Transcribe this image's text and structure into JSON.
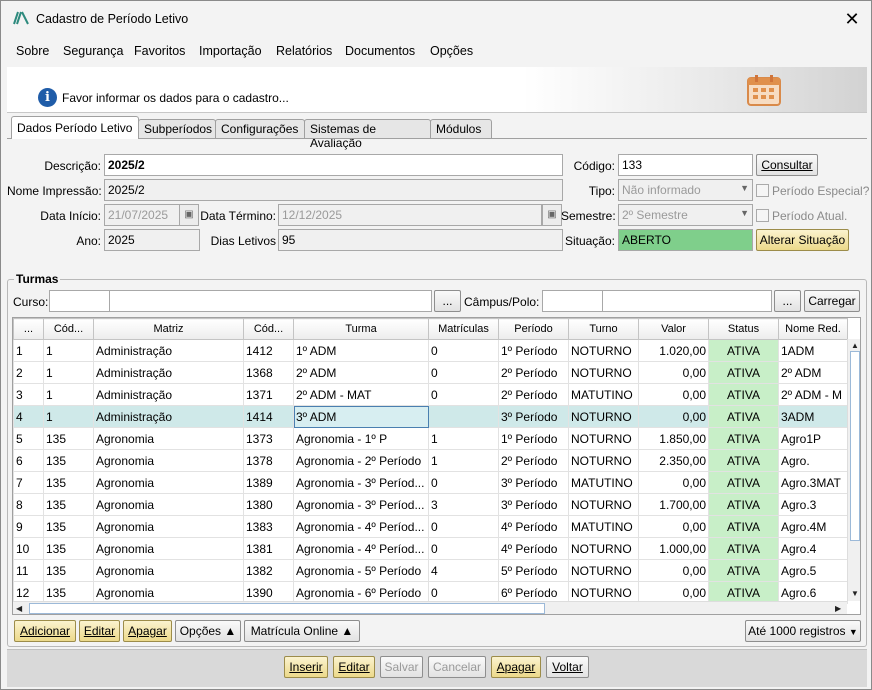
{
  "window": {
    "title": "Cadastro de Período Letivo",
    "close_label": "✕"
  },
  "menu": [
    "Sobre",
    "Segurança",
    "Favoritos",
    "Importação",
    "Relatórios",
    "Documentos",
    "Opções"
  ],
  "info": {
    "message": "Favor informar os dados para o cadastro..."
  },
  "tabs": [
    "Dados Período Letivo",
    "Subperíodos",
    "Configurações",
    "Sistemas de Avaliação",
    "Módulos"
  ],
  "form": {
    "descricao_label": "Descrição:",
    "descricao": "2025/2",
    "nome_impressao_label": "Nome Impressão:",
    "nome_impressao": "2025/2",
    "data_inicio_label": "Data Início:",
    "data_inicio": "21/07/2025",
    "data_termino_label": "Data Término:",
    "data_termino": "12/12/2025",
    "ano_label": "Ano:",
    "ano": "2025",
    "dias_letivos_label": "Dias Letivos",
    "dias_letivos": "95",
    "codigo_label": "Código:",
    "codigo": "133",
    "consultar_label": "Consultar",
    "tipo_label": "Tipo:",
    "tipo": "Não informado",
    "periodo_especial_label": "Período Especial?",
    "semestre_label": "Semestre:",
    "semestre": "2º Semestre",
    "periodo_atual_label": "Período Atual.",
    "situacao_label": "Situação:",
    "situacao": "ABERTO",
    "alterar_situacao_label": "Alterar Situação",
    "situacao_color": "#7fcf8b"
  },
  "turmas": {
    "title": "Turmas",
    "curso_label": "Curso:",
    "campus_label": "Câmpus/Polo:",
    "ellipsis": "...",
    "carregar_label": "Carregar",
    "columns": [
      "...",
      "Cód...",
      "Matriz",
      "Cód...",
      "Turma",
      "Matrículas",
      "Período",
      "Turno",
      "Valor",
      "Status",
      "Nome Red."
    ],
    "rows": [
      [
        "1",
        "1",
        "Administração",
        "1412",
        "1º ADM",
        "0",
        "1º Período",
        "NOTURNO",
        "1.020,00",
        "ATIVA",
        "1ADM"
      ],
      [
        "2",
        "1",
        "Administração",
        "1368",
        "2º ADM",
        "0",
        "2º Período",
        "NOTURNO",
        "0,00",
        "ATIVA",
        "2º ADM"
      ],
      [
        "3",
        "1",
        "Administração",
        "1371",
        "2º ADM - MAT",
        "0",
        "2º Período",
        "MATUTINO",
        "0,00",
        "ATIVA",
        "2º ADM - M"
      ],
      [
        "4",
        "1",
        "Administração",
        "1414",
        "3º ADM",
        "",
        "3º Período",
        "NOTURNO",
        "0,00",
        "ATIVA",
        "3ADM"
      ],
      [
        "5",
        "135",
        "Agronomia",
        "1373",
        "Agronomia - 1º P",
        "1",
        "1º Período",
        "NOTURNO",
        "1.850,00",
        "ATIVA",
        "Agro1P"
      ],
      [
        "6",
        "135",
        "Agronomia",
        "1378",
        "Agronomia - 2º Período",
        "1",
        "2º Período",
        "NOTURNO",
        "2.350,00",
        "ATIVA",
        "Agro."
      ],
      [
        "7",
        "135",
        "Agronomia",
        "1389",
        "Agronomia - 3º Períod...",
        "0",
        "3º Período",
        "MATUTINO",
        "0,00",
        "ATIVA",
        "Agro.3MAT"
      ],
      [
        "8",
        "135",
        "Agronomia",
        "1380",
        "Agronomia - 3º Períod...",
        "3",
        "3º Período",
        "NOTURNO",
        "1.700,00",
        "ATIVA",
        "Agro.3"
      ],
      [
        "9",
        "135",
        "Agronomia",
        "1383",
        "Agronomia - 4º Períod...",
        "0",
        "4º Período",
        "MATUTINO",
        "0,00",
        "ATIVA",
        "Agro.4M"
      ],
      [
        "10",
        "135",
        "Agronomia",
        "1381",
        "Agronomia - 4º Períod...",
        "0",
        "4º Período",
        "NOTURNO",
        "1.000,00",
        "ATIVA",
        "Agro.4"
      ],
      [
        "11",
        "135",
        "Agronomia",
        "1382",
        "Agronomia - 5º Período",
        "4",
        "5º Período",
        "NOTURNO",
        "0,00",
        "ATIVA",
        "Agro.5"
      ],
      [
        "12",
        "135",
        "Agronomia",
        "1390",
        "Agronomia - 6º Período",
        "0",
        "6º Período",
        "NOTURNO",
        "0,00",
        "ATIVA",
        "Agro.6"
      ]
    ],
    "selected_row": "4",
    "status_color": "#c8efc8",
    "adicionar_label": "Adicionar",
    "editar_label": "Editar",
    "apagar_label": "Apagar",
    "opcoes_label": "Opções",
    "matricula_online_label": "Matrícula Online",
    "registros_label": "Até 1000 registros"
  },
  "footer": {
    "inserir": "Inserir",
    "editar": "Editar",
    "salvar": "Salvar",
    "cancelar": "Cancelar",
    "apagar": "Apagar",
    "voltar": "Voltar"
  }
}
